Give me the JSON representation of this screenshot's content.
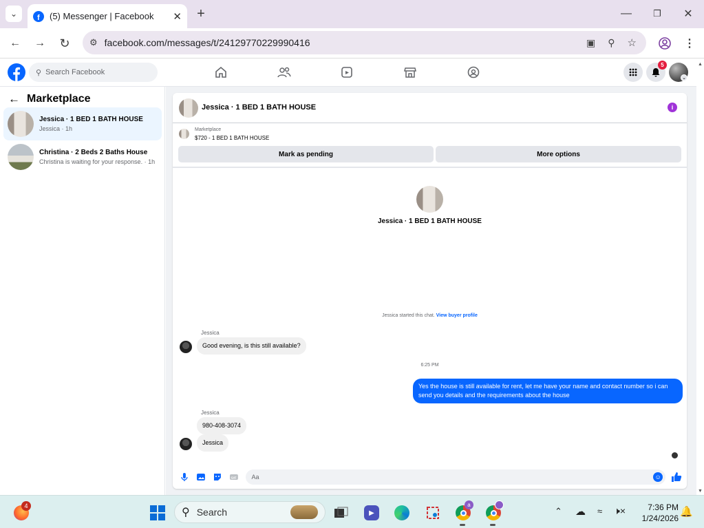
{
  "browser": {
    "tab_title": "(5) Messenger | Facebook",
    "url": "facebook.com/messages/t/24129770229990416"
  },
  "fb": {
    "search_placeholder": "Search Facebook",
    "notification_count": "5"
  },
  "sidebar": {
    "title": "Marketplace",
    "conversations": [
      {
        "title": "Jessica · 1 BED 1 BATH HOUSE",
        "subtitle": "Jessica · 1h"
      },
      {
        "title": "Christina · 2 Beds 2 Baths House",
        "subtitle": "Christina is waiting for your response. · 1h"
      }
    ]
  },
  "chat": {
    "title": "Jessica · 1 BED 1 BATH HOUSE",
    "listing_label": "Marketplace",
    "listing_price": "$720 - 1 BED 1 BATH HOUSE",
    "mark_pending_label": "Mark as pending",
    "more_options_label": "More options",
    "intro_title": "Jessica · 1 BED 1 BATH HOUSE",
    "started_text": "Jessica started this chat.",
    "view_profile_link": "View buyer profile",
    "messages": [
      {
        "sender": "Jessica",
        "text": "Good evening, is this still available?"
      },
      {
        "timestamp": "6:25 PM"
      },
      {
        "text": "Yes the house is still available for rent, let me have your name and  contact number so i can send you details and the requirements about the house"
      },
      {
        "sender": "Jessica",
        "text": "980-408-3074"
      },
      {
        "text": "Jessica"
      }
    ],
    "composer_placeholder": "Aa",
    "accent": "#0866ff"
  },
  "taskbar": {
    "search_label": "Search",
    "time": "7:36 PM",
    "date": "1/24/2026",
    "badge_firefox": "4",
    "badge_chrome": "a"
  }
}
